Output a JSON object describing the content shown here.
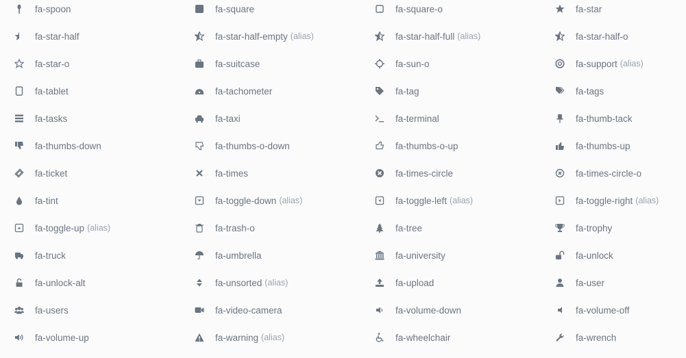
{
  "icons": [
    {
      "name": "fa-spoon",
      "alias": "",
      "icon": "spoon-icon"
    },
    {
      "name": "fa-square",
      "alias": "",
      "icon": "square-icon"
    },
    {
      "name": "fa-square-o",
      "alias": "",
      "icon": "square-o-icon"
    },
    {
      "name": "fa-star",
      "alias": "",
      "icon": "star-icon"
    },
    {
      "name": "fa-star-half",
      "alias": "",
      "icon": "star-half-icon"
    },
    {
      "name": "fa-star-half-empty",
      "alias": "(alias)",
      "icon": "star-half-empty-icon"
    },
    {
      "name": "fa-star-half-full",
      "alias": "(alias)",
      "icon": "star-half-full-icon"
    },
    {
      "name": "fa-star-half-o",
      "alias": "",
      "icon": "star-half-o-icon"
    },
    {
      "name": "fa-star-o",
      "alias": "",
      "icon": "star-o-icon"
    },
    {
      "name": "fa-suitcase",
      "alias": "",
      "icon": "suitcase-icon"
    },
    {
      "name": "fa-sun-o",
      "alias": "",
      "icon": "sun-o-icon"
    },
    {
      "name": "fa-support",
      "alias": "(alias)",
      "icon": "support-icon"
    },
    {
      "name": "fa-tablet",
      "alias": "",
      "icon": "tablet-icon"
    },
    {
      "name": "fa-tachometer",
      "alias": "",
      "icon": "tachometer-icon"
    },
    {
      "name": "fa-tag",
      "alias": "",
      "icon": "tag-icon"
    },
    {
      "name": "fa-tags",
      "alias": "",
      "icon": "tags-icon"
    },
    {
      "name": "fa-tasks",
      "alias": "",
      "icon": "tasks-icon"
    },
    {
      "name": "fa-taxi",
      "alias": "",
      "icon": "taxi-icon"
    },
    {
      "name": "fa-terminal",
      "alias": "",
      "icon": "terminal-icon"
    },
    {
      "name": "fa-thumb-tack",
      "alias": "",
      "icon": "thumb-tack-icon"
    },
    {
      "name": "fa-thumbs-down",
      "alias": "",
      "icon": "thumbs-down-icon"
    },
    {
      "name": "fa-thumbs-o-down",
      "alias": "",
      "icon": "thumbs-o-down-icon"
    },
    {
      "name": "fa-thumbs-o-up",
      "alias": "",
      "icon": "thumbs-o-up-icon"
    },
    {
      "name": "fa-thumbs-up",
      "alias": "",
      "icon": "thumbs-up-icon"
    },
    {
      "name": "fa-ticket",
      "alias": "",
      "icon": "ticket-icon"
    },
    {
      "name": "fa-times",
      "alias": "",
      "icon": "times-icon"
    },
    {
      "name": "fa-times-circle",
      "alias": "",
      "icon": "times-circle-icon"
    },
    {
      "name": "fa-times-circle-o",
      "alias": "",
      "icon": "times-circle-o-icon"
    },
    {
      "name": "fa-tint",
      "alias": "",
      "icon": "tint-icon"
    },
    {
      "name": "fa-toggle-down",
      "alias": "(alias)",
      "icon": "toggle-down-icon"
    },
    {
      "name": "fa-toggle-left",
      "alias": "(alias)",
      "icon": "toggle-left-icon"
    },
    {
      "name": "fa-toggle-right",
      "alias": "(alias)",
      "icon": "toggle-right-icon"
    },
    {
      "name": "fa-toggle-up",
      "alias": "(alias)",
      "icon": "toggle-up-icon"
    },
    {
      "name": "fa-trash-o",
      "alias": "",
      "icon": "trash-o-icon"
    },
    {
      "name": "fa-tree",
      "alias": "",
      "icon": "tree-icon"
    },
    {
      "name": "fa-trophy",
      "alias": "",
      "icon": "trophy-icon"
    },
    {
      "name": "fa-truck",
      "alias": "",
      "icon": "truck-icon"
    },
    {
      "name": "fa-umbrella",
      "alias": "",
      "icon": "umbrella-icon"
    },
    {
      "name": "fa-university",
      "alias": "",
      "icon": "university-icon"
    },
    {
      "name": "fa-unlock",
      "alias": "",
      "icon": "unlock-icon"
    },
    {
      "name": "fa-unlock-alt",
      "alias": "",
      "icon": "unlock-alt-icon"
    },
    {
      "name": "fa-unsorted",
      "alias": "(alias)",
      "icon": "unsorted-icon"
    },
    {
      "name": "fa-upload",
      "alias": "",
      "icon": "upload-icon"
    },
    {
      "name": "fa-user",
      "alias": "",
      "icon": "user-icon"
    },
    {
      "name": "fa-users",
      "alias": "",
      "icon": "users-icon"
    },
    {
      "name": "fa-video-camera",
      "alias": "",
      "icon": "video-camera-icon"
    },
    {
      "name": "fa-volume-down",
      "alias": "",
      "icon": "volume-down-icon"
    },
    {
      "name": "fa-volume-off",
      "alias": "",
      "icon": "volume-off-icon"
    },
    {
      "name": "fa-volume-up",
      "alias": "",
      "icon": "volume-up-icon"
    },
    {
      "name": "fa-warning",
      "alias": "(alias)",
      "icon": "warning-icon"
    },
    {
      "name": "fa-wheelchair",
      "alias": "",
      "icon": "wheelchair-icon"
    },
    {
      "name": "fa-wrench",
      "alias": "",
      "icon": "wrench-icon"
    }
  ],
  "colors": {
    "text": "#6b7580",
    "alias": "#9aa3ad",
    "background": "#fbfbfc"
  }
}
